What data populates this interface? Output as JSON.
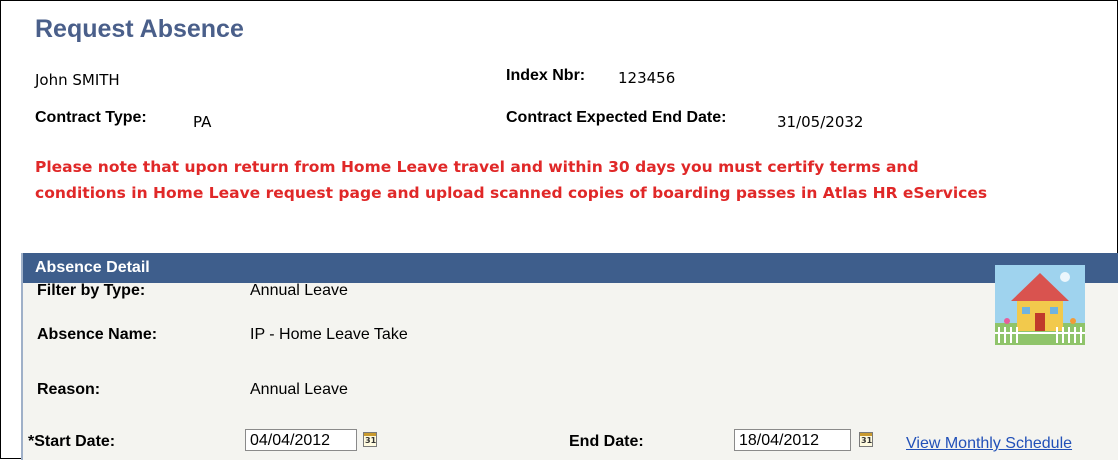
{
  "page": {
    "title": "Request Absence"
  },
  "employee": {
    "name": "John SMITH",
    "index_label": "Index Nbr:",
    "index_value": "123456",
    "contract_type_label": "Contract Type:",
    "contract_type_value": "PA",
    "contract_end_label": "Contract Expected End Date:",
    "contract_end_value": "31/05/2032"
  },
  "notice": {
    "line1": "Please note that upon return from Home Leave travel and within 30 days you must certify terms and",
    "line2": "conditions in Home Leave request page and upload scanned copies of boarding passes in Atlas HR eServices",
    "color": "#e02828"
  },
  "absence_detail": {
    "header": "Absence Detail",
    "filter_label": "Filter by Type:",
    "filter_value": "Annual Leave",
    "absence_name_label": "Absence Name:",
    "absence_name_value": "IP - Home Leave Take",
    "reason_label": "Reason:",
    "reason_value": "Annual Leave",
    "start_date_label": "*Start Date:",
    "start_date_value": "04/04/2012",
    "end_date_label": "End Date:",
    "end_date_value": "18/04/2012",
    "calendar_icon_glyph": "31",
    "schedule_link": "View Monthly Schedule",
    "header_color": "#3e5e8c"
  },
  "icons": {
    "calendar": "calendar-icon",
    "house": "house-illustration-icon"
  }
}
